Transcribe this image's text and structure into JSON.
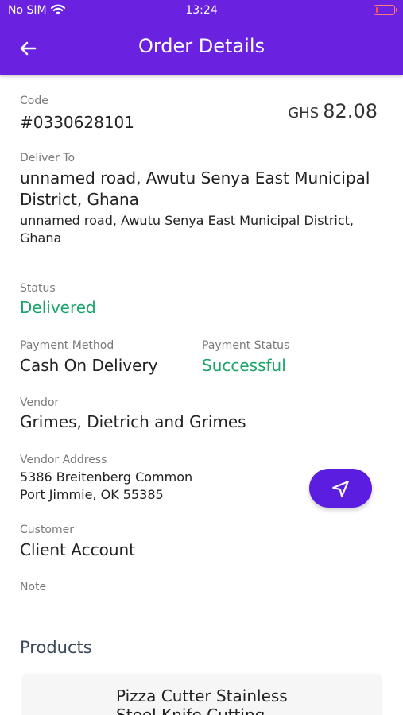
{
  "status_bar": {
    "carrier": "No SIM",
    "time": "13:24",
    "battery_level": 0.15
  },
  "header": {
    "title": "Order Details"
  },
  "order": {
    "code_label": "Code",
    "code": "#0330628101",
    "currency": "GHS",
    "amount": "82.08",
    "deliver_label": "Deliver To",
    "deliver_name": "unnamed road, Awutu Senya East Municipal District, Ghana",
    "deliver_address": "unnamed road, Awutu Senya East Municipal District, Ghana",
    "status_label": "Status",
    "status": "Delivered",
    "payment_method_label": "Payment Method",
    "payment_method": "Cash On Delivery",
    "payment_status_label": "Payment Status",
    "payment_status": "Successful",
    "vendor_label": "Vendor",
    "vendor": "Grimes, Dietrich and Grimes",
    "vendor_address_label": "Vendor Address",
    "vendor_address_line1": "5386 Breitenberg Common",
    "vendor_address_line2": "Port Jimmie, OK 55385",
    "customer_label": "Customer",
    "customer": "Client Account",
    "note_label": "Note",
    "note": ""
  },
  "products": {
    "section_title": "Products",
    "items": [
      {
        "name": "Pizza Cutter Stainless Steel Knife Cutting"
      }
    ]
  },
  "colors": {
    "primary": "#6a22e0",
    "button": "#5b1ee0",
    "success": "#1ba46a"
  },
  "icons": {
    "back": "arrow-left-icon",
    "navigate": "navigation-arrow-icon",
    "wifi": "wifi-icon",
    "battery": "battery-icon"
  }
}
